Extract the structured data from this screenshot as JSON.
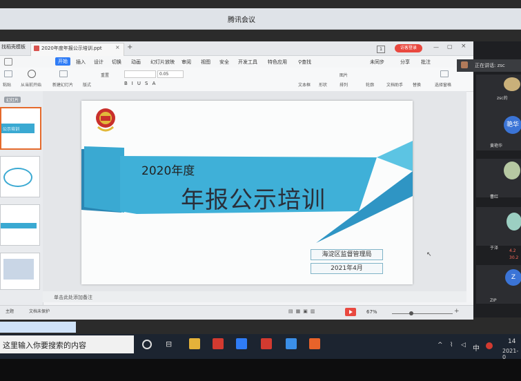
{
  "meeting": {
    "app_title": "腾讯会议",
    "speaking": "正在讲话: zsc",
    "participants": [
      {
        "name": "zsc的",
        "avatar_text": ""
      },
      {
        "name": "黄艳华",
        "avatar_text": "艳华"
      },
      {
        "name": "曹红",
        "avatar_text": ""
      },
      {
        "name": "于泽",
        "avatar_text": ""
      },
      {
        "name": "ZIP",
        "avatar_text": "Z"
      }
    ],
    "stats": [
      "4.2",
      "30.2"
    ]
  },
  "wps": {
    "left_tab": "找稻壳模板",
    "doc_tab": "2020年度年报公示培训.ppt",
    "login": "访客登录",
    "menu": [
      "开始",
      "插入",
      "设计",
      "切换",
      "动画",
      "幻灯片放映",
      "审阅",
      "视图",
      "安全",
      "开发工具",
      "特色应用",
      "查找"
    ],
    "right_menu": [
      "未同步",
      "分享",
      "批注"
    ],
    "ribbon": {
      "paste": "粘贴",
      "from_current": "从当前开始",
      "new_slide": "新建幻灯片",
      "layout": "版式",
      "reset": "重置",
      "font_size": "0.05",
      "textbox": "文本框",
      "shapes": "形状",
      "arrange": "排列",
      "outline": "轮廓",
      "doc_helper": "文档助手",
      "select_pane": "选择窗格",
      "picture": "图片",
      "replace": "替换"
    },
    "panel_label": "幻灯片",
    "thumb1_text": "公示培训",
    "slide": {
      "year": "2020年度",
      "title": "年报公示培训",
      "org": "海淀区监督管理局",
      "date": "2021年4月"
    },
    "notes": "单击此处添加备注",
    "status_theme": "主题",
    "status_protect": "文档未保护",
    "zoom": "67%"
  },
  "taskbar": {
    "search": "这里输入你要搜索的内容",
    "input_method": "中",
    "time": "14",
    "date": "2021-0"
  },
  "colors": {
    "ribbon_blue": "#3aa9d2",
    "ribbon_dark": "#2a86b3",
    "accent_red": "#e9483f",
    "start_blue": "#2f7cf6"
  }
}
